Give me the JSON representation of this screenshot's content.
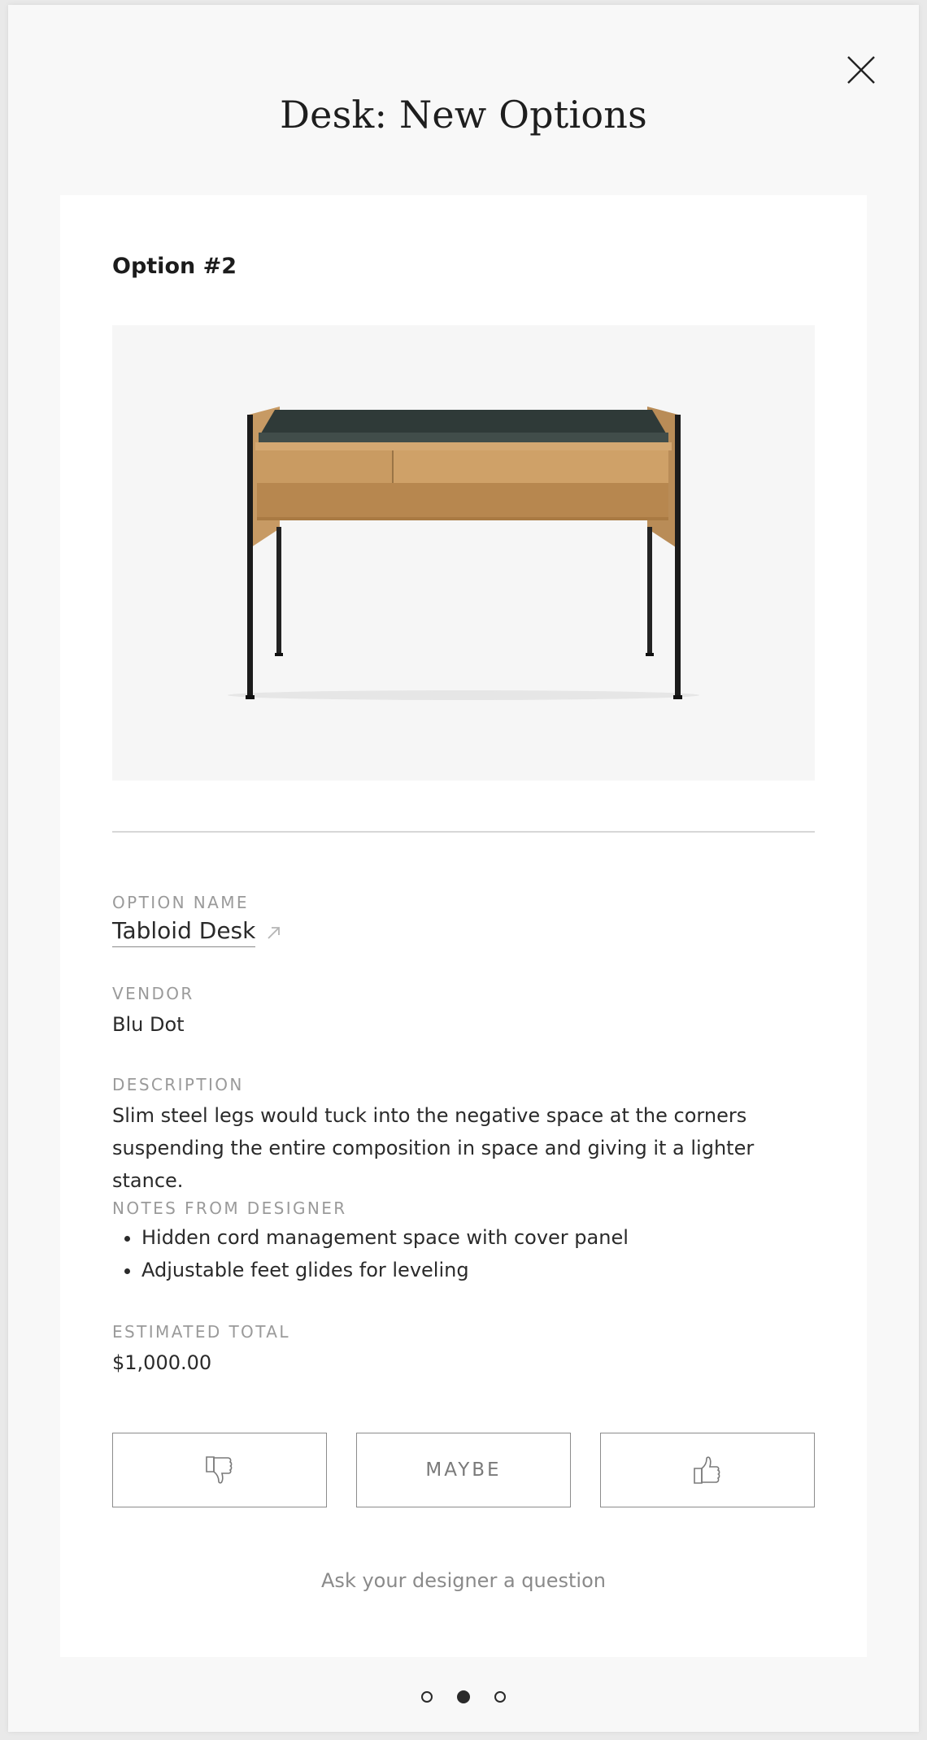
{
  "modal": {
    "title": "Desk: New Options",
    "close_icon": "close-icon"
  },
  "option": {
    "label": "Option #2",
    "image_alt": "desk-product-image",
    "fields": {
      "name_label": "OPTION NAME",
      "name_value": "Tabloid Desk",
      "vendor_label": "VENDOR",
      "vendor_value": "Blu Dot",
      "description_label": "DESCRIPTION",
      "description_value": "Slim steel legs would tuck into the negative space at the corners suspending the entire composition in space and giving it a lighter stance.",
      "notes_label": "NOTES FROM DESIGNER",
      "notes": [
        "Hidden cord management space with cover panel",
        "Adjustable feet glides for leveling"
      ],
      "total_label": "ESTIMATED TOTAL",
      "total_value": "$1,000.00"
    }
  },
  "actions": {
    "dislike_icon": "thumbs-down-icon",
    "maybe_label": "MAYBE",
    "like_icon": "thumbs-up-icon",
    "ask_label": "Ask your designer a question"
  },
  "pagination": {
    "total": 3,
    "active": 2
  },
  "colors": {
    "background": "#f8f8f8",
    "card": "#ffffff",
    "label_gray": "#9a9a9a",
    "text": "#2a2a2a"
  }
}
